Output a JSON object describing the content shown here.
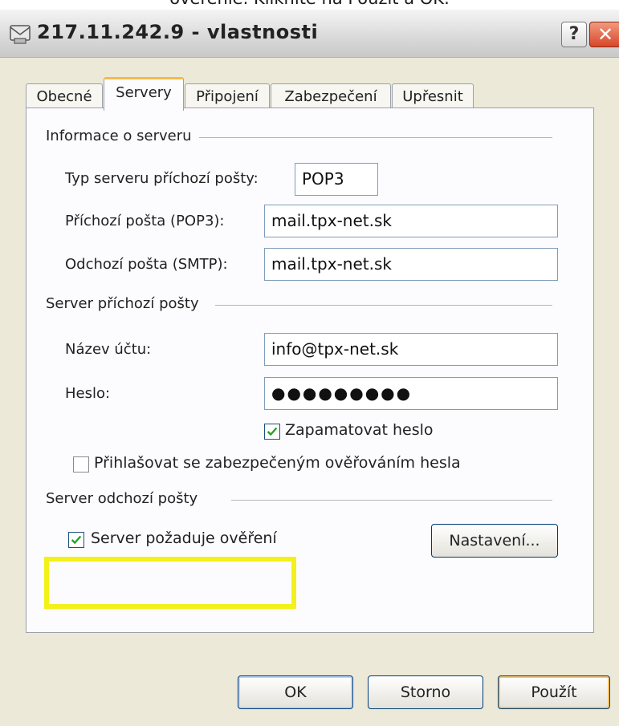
{
  "caption": "overenie. Kliknite na Použiť a OK.",
  "window": {
    "title": "217.11.242.9 - vlastnosti",
    "help_glyph": "?",
    "close_glyph": "✕",
    "title_icon": "mail-server-icon"
  },
  "tabs": [
    {
      "label": "Obecné"
    },
    {
      "label": "Servery",
      "active": true
    },
    {
      "label": "Připojení"
    },
    {
      "label": "Zabezpečení"
    },
    {
      "label": "Upřesnit"
    }
  ],
  "server_info": {
    "group_label": "Informace o serveru",
    "type_label": "Typ serveru příchozí pošty:",
    "type_value": "POP3",
    "incoming_label": "Příchozí pošta (POP3):",
    "incoming_value": "mail.tpx-net.sk",
    "outgoing_label": "Odchozí pošta (SMTP):",
    "outgoing_value": "mail.tpx-net.sk"
  },
  "incoming_server": {
    "group_label": "Server příchozí pošty",
    "account_label": "Název účtu:",
    "account_value": "info@tpx-net.sk",
    "password_label": "Heslo:",
    "password_value": "●●●●●●●●●",
    "remember_label": "Zapamatovat heslo",
    "remember_checked": true,
    "spa_label": "Přihlašovat se zabezpečeným ověřováním hesla",
    "spa_checked": false
  },
  "outgoing_server": {
    "group_label": "Server odchozí pošty",
    "auth_label": "Server požaduje ověření",
    "auth_checked": true,
    "settings_button": "Nastavení...",
    "highlight_color": "#f4f01a"
  },
  "buttons": {
    "ok": "OK",
    "cancel": "Storno",
    "apply": "Použít"
  }
}
